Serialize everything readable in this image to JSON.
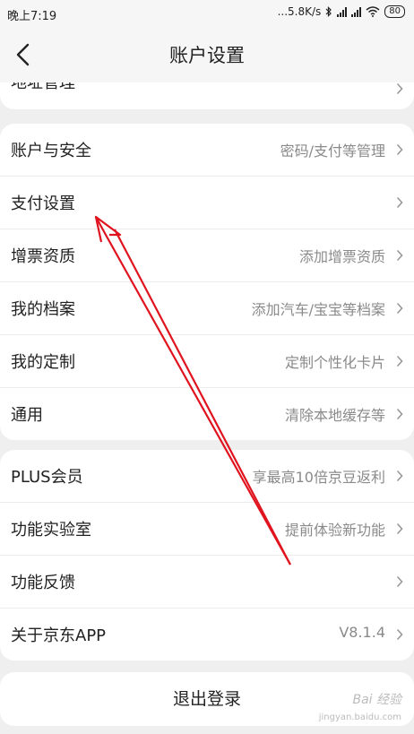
{
  "status": {
    "time": "晚上7:19",
    "net_speed": "...5.8K/s",
    "battery": "80",
    "icons": [
      "bluetooth-icon",
      "signal-icon",
      "signal-icon",
      "wifi-icon",
      "battery-icon"
    ]
  },
  "nav": {
    "title": "账户设置",
    "back_icon": "chevron-left-icon"
  },
  "partial_row": {
    "label": "地址管理"
  },
  "group1": [
    {
      "label": "账户与安全",
      "value": "密码/支付等管理"
    },
    {
      "label": "支付设置",
      "value": ""
    },
    {
      "label": "增票资质",
      "value": "添加增票资质"
    },
    {
      "label": "我的档案",
      "value": "添加汽车/宝宝等档案"
    },
    {
      "label": "我的定制",
      "value": "定制个性化卡片"
    },
    {
      "label": "通用",
      "value": "清除本地缓存等"
    }
  ],
  "group2": [
    {
      "label": "PLUS会员",
      "value": "享最高10倍京豆返利"
    },
    {
      "label": "功能实验室",
      "value": "提前体验新功能"
    },
    {
      "label": "功能反馈",
      "value": ""
    },
    {
      "label": "关于京东APP",
      "value": "V8.1.4"
    }
  ],
  "logout": {
    "label": "退出登录"
  },
  "watermark": {
    "text": "Bai 经验",
    "sub": "jingyan.baidu.com"
  },
  "colors": {
    "background": "#efefef",
    "card": "#ffffff",
    "value_text": "#8a8a8a",
    "annotation_arrow": "#e0141e"
  }
}
